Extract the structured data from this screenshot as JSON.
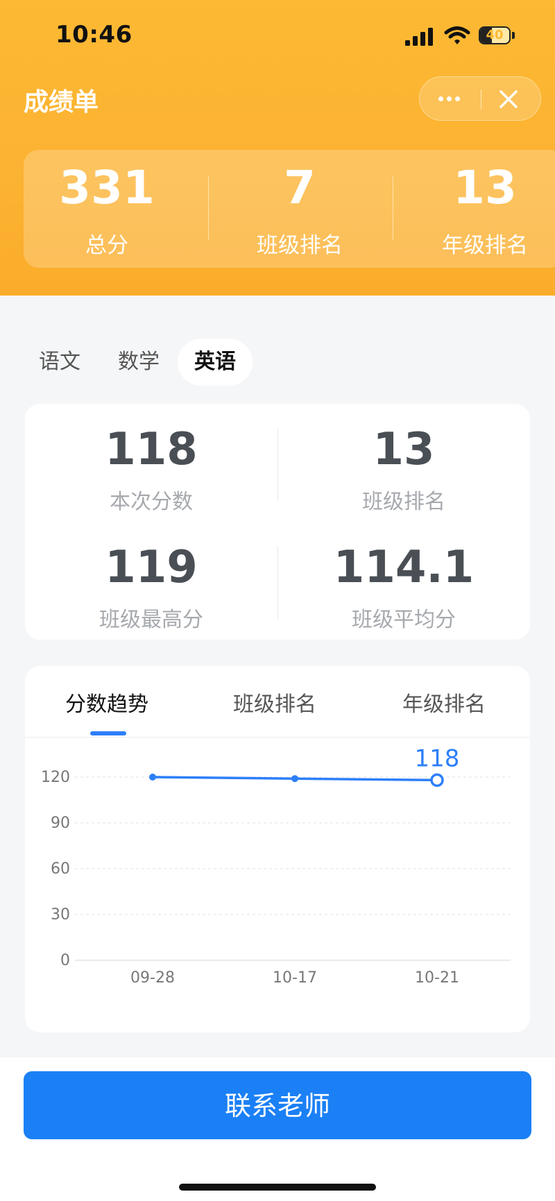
{
  "status_bar": {
    "time": "10:46",
    "battery": "40",
    "battery_level": 0.4
  },
  "header": {
    "title": "成绩单"
  },
  "summary": [
    {
      "value": "331",
      "label": "总分"
    },
    {
      "value": "7",
      "label": "班级排名"
    },
    {
      "value": "13",
      "label": "年级排名"
    }
  ],
  "subjects": {
    "tabs": [
      "语文",
      "数学",
      "英语"
    ],
    "active_index": 2
  },
  "stats": {
    "score": {
      "value": "118",
      "label": "本次分数"
    },
    "class_rank": {
      "value": "13",
      "label": "班级排名"
    },
    "class_max": {
      "value": "119",
      "label": "班级最高分"
    },
    "class_avg": {
      "value": "114.1",
      "label": "班级平均分"
    }
  },
  "chart_tabs": {
    "tabs": [
      "分数趋势",
      "班级排名",
      "年级排名"
    ],
    "active_index": 0
  },
  "chart_data": {
    "type": "line",
    "categories": [
      "09-28",
      "10-17",
      "10-21"
    ],
    "series": [
      {
        "values": [
          120,
          119,
          118
        ]
      }
    ],
    "y_ticks": [
      "120",
      "90",
      "60",
      "30",
      "0"
    ],
    "ylim": [
      0,
      120
    ],
    "highlight_label": "118",
    "line_color": "#2d7ff9",
    "grid": true
  },
  "footer": {
    "contact_button": "联系老师"
  },
  "colors": {
    "accent": "#fdb933",
    "primary_blue": "#1b80f5"
  }
}
